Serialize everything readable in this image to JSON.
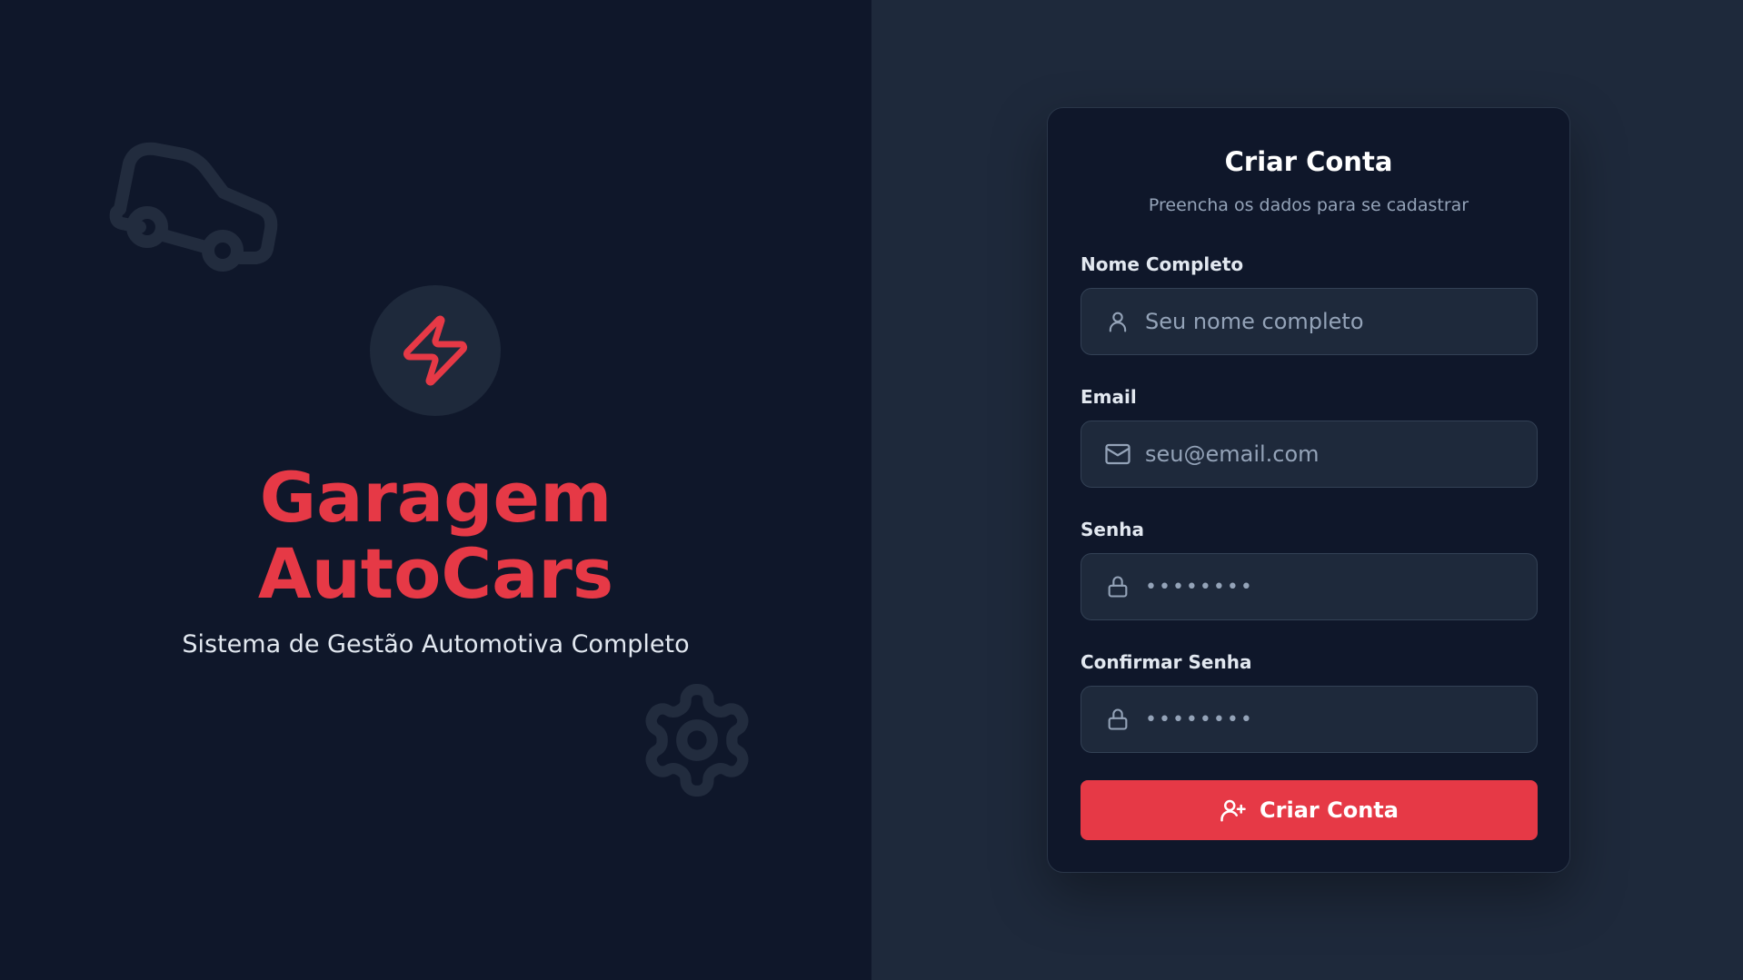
{
  "brand": {
    "title_line1": "Garagem",
    "title_line2": "AutoCars",
    "subtitle": "Sistema de Gestão Automotiva Completo",
    "logo_icon": "zap-icon",
    "accent_color": "#e63946"
  },
  "decorations": {
    "top_icon": "car-icon",
    "bottom_icon": "gear-icon"
  },
  "form": {
    "title": "Criar Conta",
    "subtitle": "Preencha os dados para se cadastrar",
    "fields": [
      {
        "label": "Nome Completo",
        "placeholder": "Seu nome completo",
        "value": "",
        "icon": "user-icon",
        "type": "text"
      },
      {
        "label": "Email",
        "placeholder": "seu@email.com",
        "value": "",
        "icon": "mail-icon",
        "type": "email"
      },
      {
        "label": "Senha",
        "placeholder": "••••••••",
        "value": "",
        "icon": "lock-icon",
        "type": "password"
      },
      {
        "label": "Confirmar Senha",
        "placeholder": "••••••••",
        "value": "",
        "icon": "lock-icon",
        "type": "password"
      }
    ],
    "submit": {
      "label": "Criar Conta",
      "icon": "user-plus-icon"
    }
  },
  "colors": {
    "left_bg": "#0f172a",
    "right_bg": "#1e293b",
    "card_bg": "#0f172a",
    "input_bg": "#1e293b",
    "button_bg": "#e63946"
  }
}
